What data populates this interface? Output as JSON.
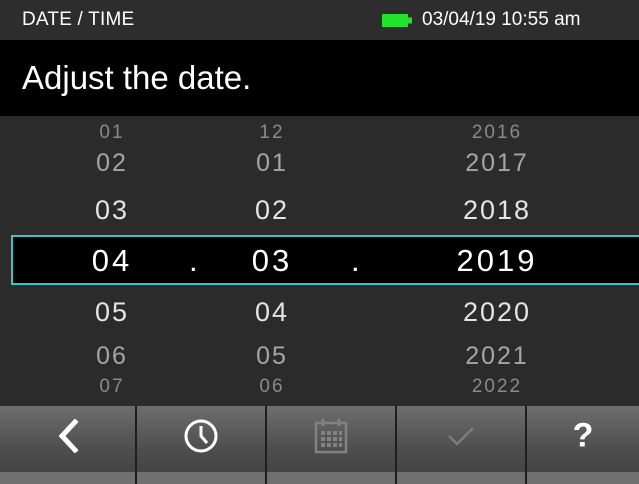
{
  "status_bar": {
    "title": "DATE / TIME",
    "battery_icon": "battery-icon",
    "datetime": "03/04/19 10:55 am"
  },
  "instruction": "Adjust the date.",
  "picker": {
    "day": {
      "rows": [
        "01",
        "02",
        "03",
        "05",
        "06",
        "07"
      ],
      "selected": "04"
    },
    "month": {
      "rows": [
        "12",
        "01",
        "02",
        "04",
        "05",
        "06"
      ],
      "selected": "03"
    },
    "year": {
      "rows": [
        "2016",
        "2017",
        "2018",
        "2020",
        "2021",
        "2022"
      ],
      "selected": "2019"
    },
    "separator": "."
  },
  "buttons": [
    {
      "name": "back-button",
      "icon": "chevron-left-icon",
      "enabled": true
    },
    {
      "name": "time-button",
      "icon": "clock-icon",
      "enabled": true
    },
    {
      "name": "date-button",
      "icon": "calendar-icon",
      "enabled": false
    },
    {
      "name": "confirm-button",
      "icon": "checkmark-icon",
      "enabled": false
    },
    {
      "name": "help-button",
      "icon": "question-icon",
      "label": "?",
      "enabled": true
    }
  ],
  "colors": {
    "selection_border": "#35c6c6",
    "battery": "#22e22a"
  }
}
